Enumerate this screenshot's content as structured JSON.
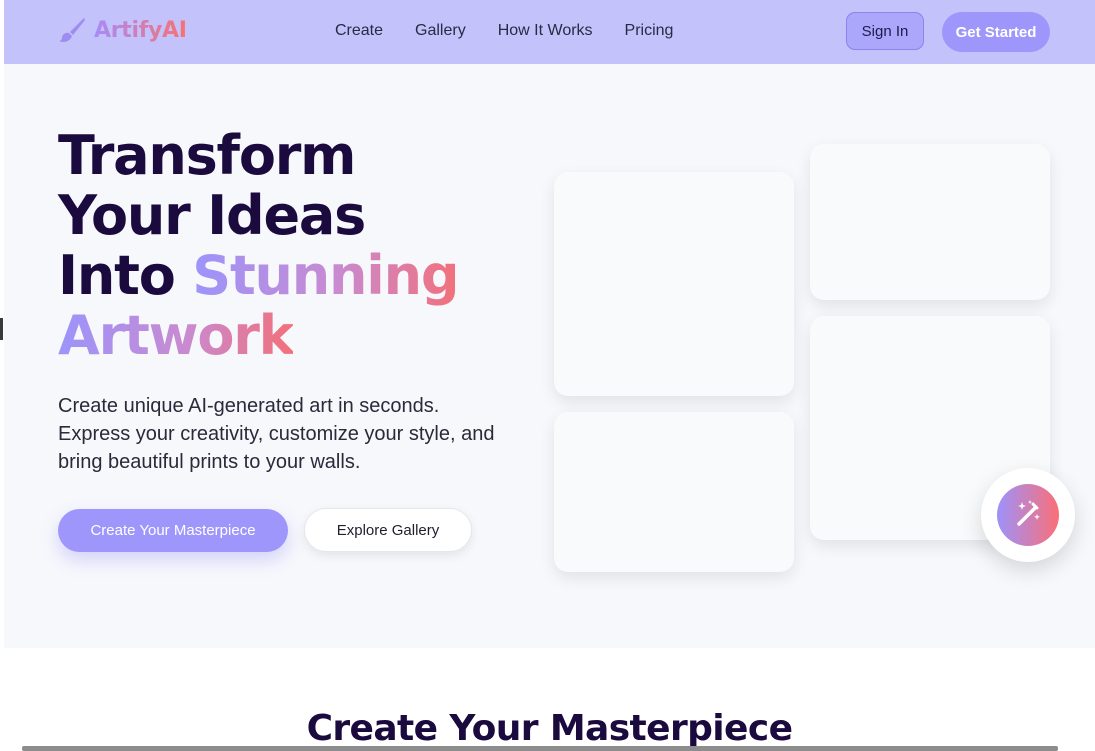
{
  "header": {
    "brand": "ArtifyAI",
    "nav": [
      "Create",
      "Gallery",
      "How It Works",
      "Pricing"
    ],
    "sign_in": "Sign In",
    "get_started": "Get Started"
  },
  "hero": {
    "title_line1": "Transform",
    "title_line2": "Your Ideas",
    "title_line3_plain": "Into ",
    "title_line3_accent": "Stunning",
    "title_line4_accent": "Artwork",
    "subtitle": "Create unique AI-generated art in seconds. Express your creativity, customize your style, and bring beautiful prints to your walls.",
    "primary_button": "Create Your Masterpiece",
    "secondary_button": "Explore Gallery",
    "fab_icon": "magic-wand-icon"
  },
  "next_section": {
    "title": "Create Your Masterpiece"
  },
  "colors": {
    "nav_bg": "#c3c2fb",
    "accent": "#9e96fb",
    "gradient_end": "#f2707a",
    "heading": "#1a0a3e"
  }
}
